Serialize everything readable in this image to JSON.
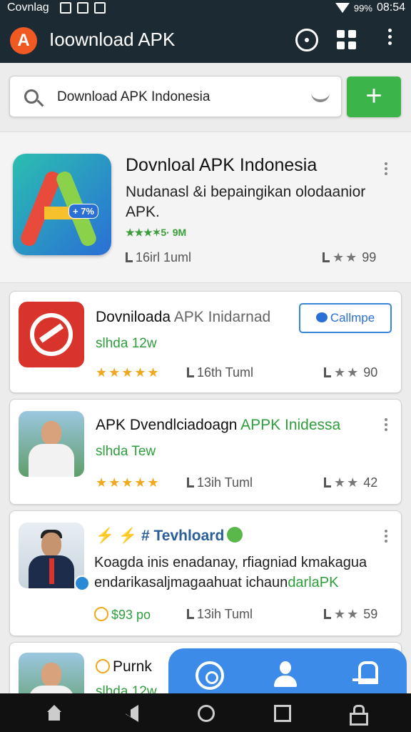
{
  "status_bar": {
    "carrier": "Covnlag",
    "battery": "99%",
    "time": "08:54"
  },
  "appbar": {
    "logo_letter": "A",
    "title": "Ioownload APK",
    "icons": [
      "chat-icon",
      "puzzle-icon",
      "more-vertical-icon"
    ]
  },
  "search": {
    "value": "Download APK Indonesia",
    "placeholder": "Download APK Indonesia",
    "add_label": "+"
  },
  "featured": {
    "title": "Dovnloal APK Indonesia",
    "description": "Nudanasl &i bepaingikan olodaanior APK.",
    "badge": "+ 7%",
    "rating_text": "★★★✶5· 9M",
    "downloads": "16irl  1uml",
    "score": "99"
  },
  "cards": [
    {
      "name_main": "Dovniloada ",
      "name_muted": "APK Inidarnad",
      "button": "Callmpe",
      "sub": "slhda 12w",
      "stars": "★★★★★",
      "downloads": "16th  Tuml",
      "score": "90"
    },
    {
      "name_main": "APK Dvendlciadoagn ",
      "name_green": "APPK Inidessa",
      "sub": "slhda Tew",
      "stars": "★★★★★",
      "downloads": "13ih  Tuml",
      "score": "42"
    },
    {
      "name_prefix": "⚡ ⚡",
      "name_hash": "# Tevhloard",
      "desc_main": "Koagda inis enadanay, rfiagniad kmakagua endarikasaljmagaahuat ichaun",
      "desc_green": "darlaPK",
      "price": "$93 po",
      "downloads": "13ih  Tuml",
      "score": "59"
    },
    {
      "name": "Purnk",
      "sub": "slhda 12w"
    }
  ],
  "colors": {
    "bar": "#1c2a33",
    "accent": "#3bb54a",
    "fab": "#3d8be8",
    "link": "#2a6fd6"
  }
}
